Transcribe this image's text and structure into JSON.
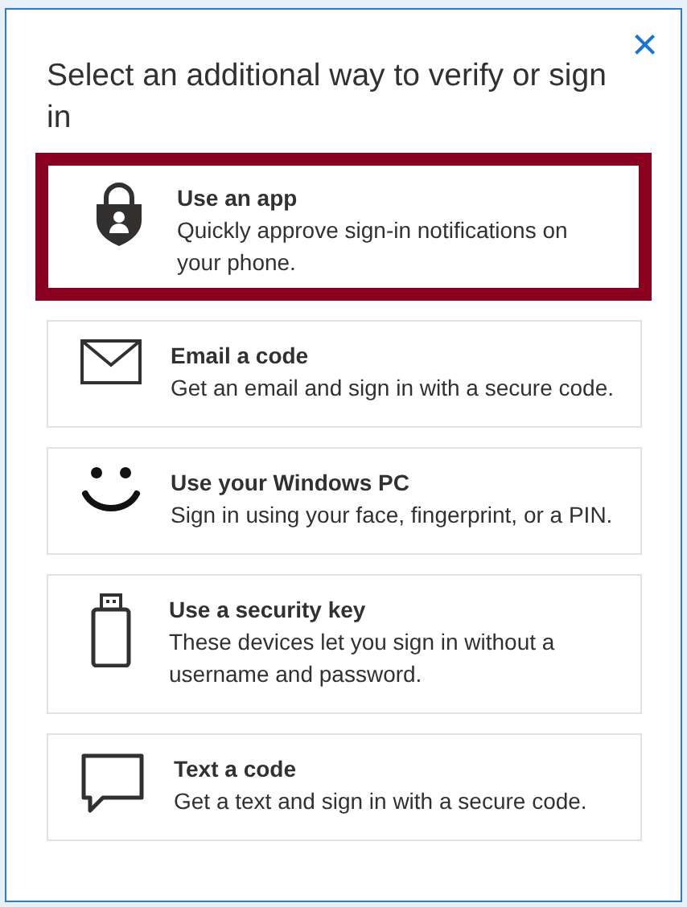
{
  "dialog": {
    "title": "Select an additional way to verify or sign in",
    "close": "×"
  },
  "options": [
    {
      "kind": "app",
      "title": "Use an app",
      "description": "Quickly approve sign-in notifications on your phone.",
      "selected": true
    },
    {
      "kind": "email",
      "title": "Email a code",
      "description": "Get an email and sign in with a secure code.",
      "selected": false
    },
    {
      "kind": "pc",
      "title": "Use your Windows PC",
      "description": "Sign in using your face, fingerprint, or a PIN.",
      "selected": false
    },
    {
      "kind": "key",
      "title": "Use a security key",
      "description": "These devices let you sign in without a username and password.",
      "selected": false
    },
    {
      "kind": "text",
      "title": "Text a code",
      "description": "Get a text and sign in with a secure code.",
      "selected": false
    }
  ]
}
